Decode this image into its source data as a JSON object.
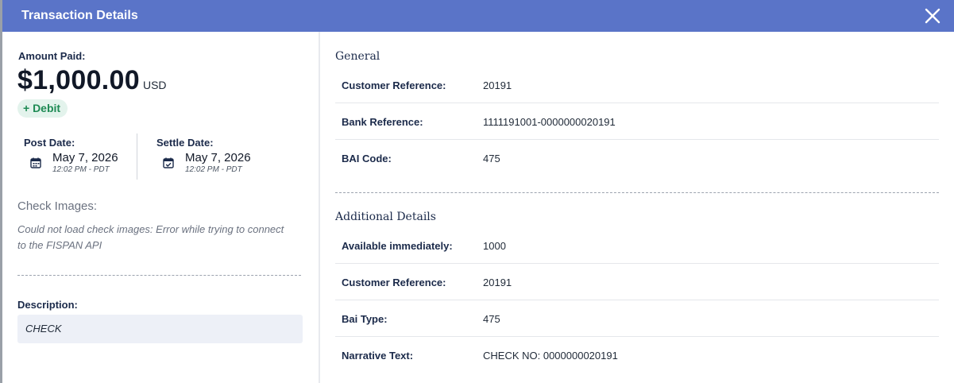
{
  "header": {
    "title": "Transaction Details"
  },
  "amount": {
    "label": "Amount Paid:",
    "value": "$1,000.00",
    "currency": "USD",
    "badge": "+ Debit"
  },
  "post_date": {
    "label": "Post Date:",
    "date": "May 7, 2026",
    "time": "12:02 PM - PDT"
  },
  "settle_date": {
    "label": "Settle Date:",
    "date": "May 7, 2026",
    "time": "12:02 PM - PDT"
  },
  "check_images": {
    "title": "Check Images:",
    "message": "Could not load check images: Error while trying to connect to the FISPAN API"
  },
  "description": {
    "label": "Description:",
    "value": "CHECK"
  },
  "general": {
    "title": "General",
    "rows": [
      {
        "label": "Customer Reference:",
        "value": "20191"
      },
      {
        "label": "Bank Reference:",
        "value": "1111191001-0000000020191"
      },
      {
        "label": "BAI Code:",
        "value": "475"
      }
    ]
  },
  "additional": {
    "title": "Additional Details",
    "rows": [
      {
        "label": "Available immediately:",
        "value": "1000"
      },
      {
        "label": "Customer Reference:",
        "value": "20191"
      },
      {
        "label": "Bai Type:",
        "value": "475"
      },
      {
        "label": "Narrative Text:",
        "value": "CHECK NO: 0000000020191"
      }
    ]
  },
  "colors": {
    "header": "#5a74c8",
    "debit": "#1d8a53",
    "debit_bg": "#e3f3ec"
  }
}
